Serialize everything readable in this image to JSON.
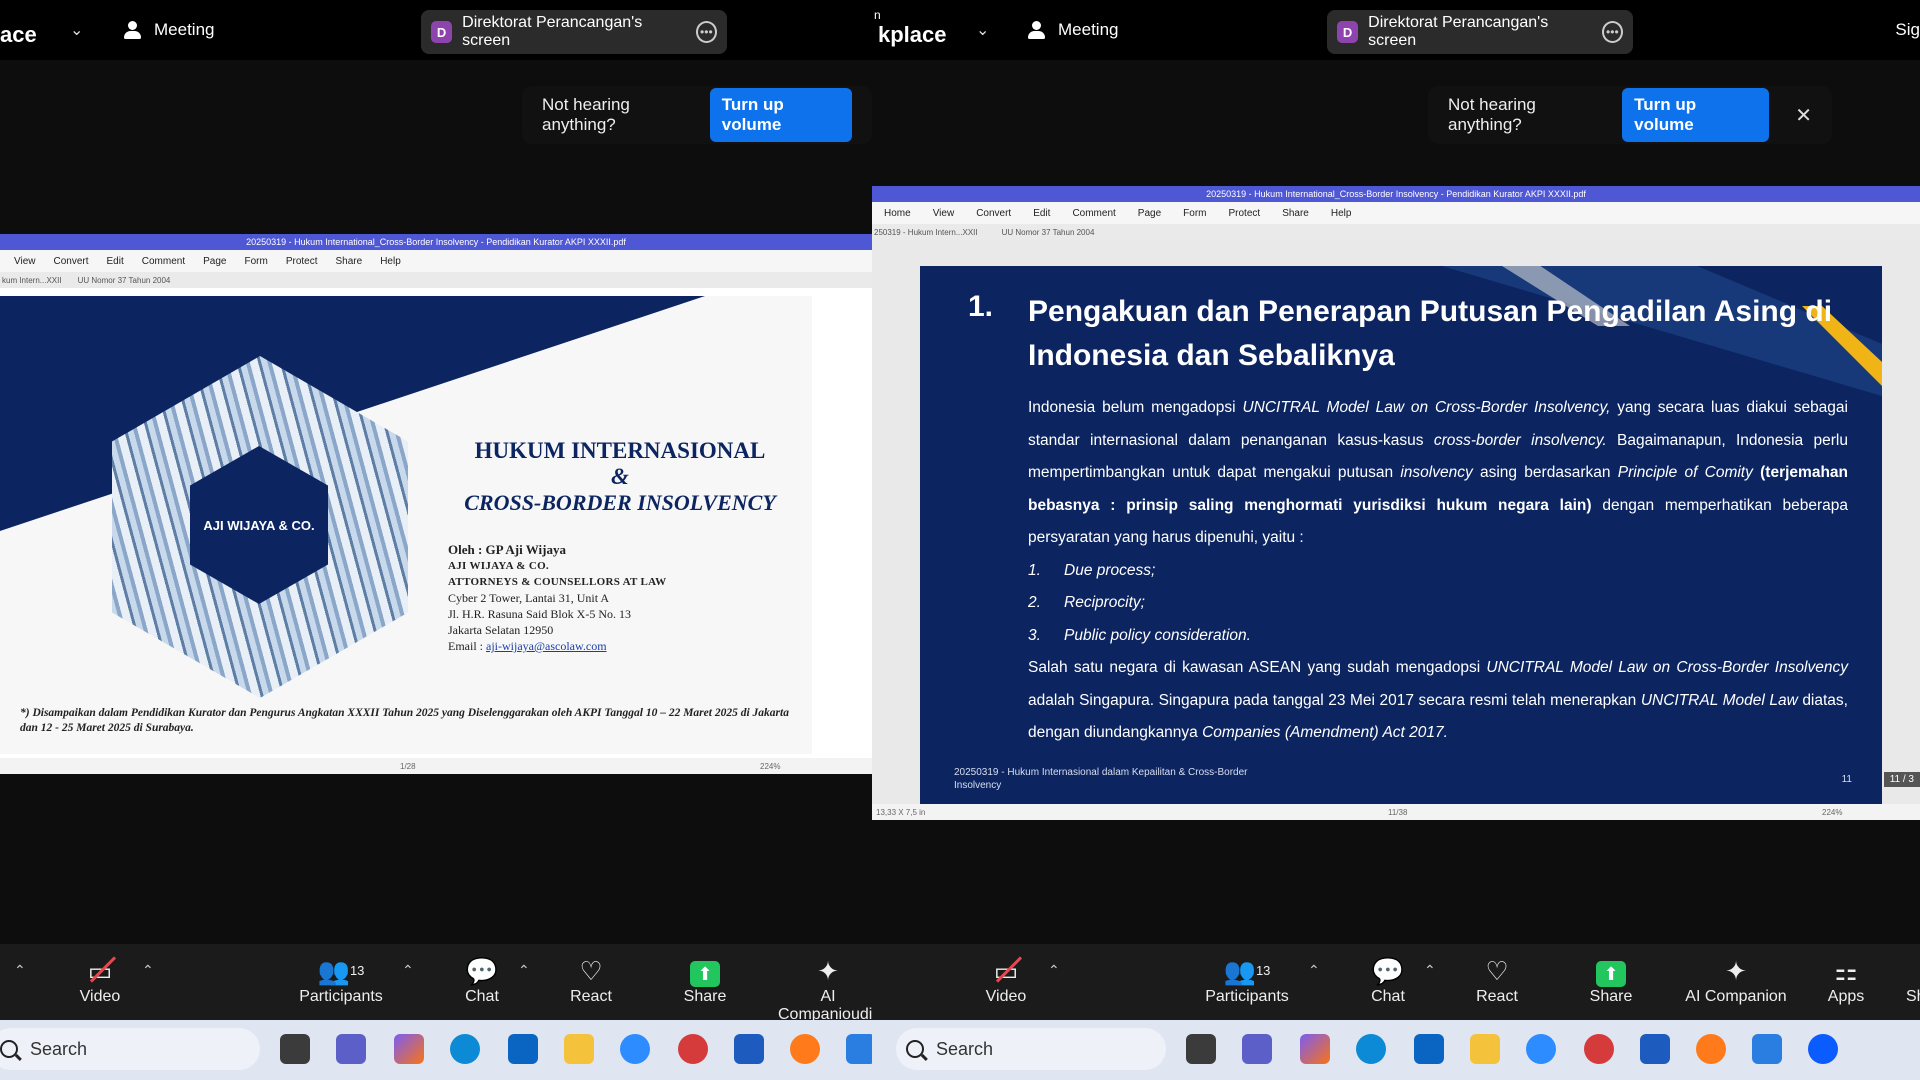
{
  "left": {
    "app_title": "ace",
    "meeting_label": "Meeting",
    "screen_share_label": "Direktorat Perancangan's screen",
    "screen_share_initial": "D",
    "notice_text": "Not hearing anything?",
    "notice_button": "Turn up volume",
    "pdf": {
      "title": "20250319 - Hukum International_Cross-Border Insolvency - Pendidikan Kurator AKPI XXXII.pdf",
      "menu": [
        "View",
        "Convert",
        "Edit",
        "Comment",
        "Page",
        "Form",
        "Protect",
        "Share",
        "Help"
      ],
      "tabs": [
        "kum Intern...XXII",
        "UU Nomor 37 Tahun 2004"
      ],
      "page_indicator": "1/28",
      "zoom": "224%"
    },
    "slide": {
      "logo_text": "AJI WIJAYA & CO.",
      "title_line1": "HUKUM INTERNASIONAL",
      "title_line2": "&",
      "title_line3": "CROSS-BORDER INSOLVENCY",
      "oleh": "Oleh : GP Aji Wijaya",
      "firm": "AJI WIJAYA & CO.",
      "firm_sub": "ATTORNEYS & COUNSELLORS AT LAW",
      "addr1": "Cyber 2 Tower, Lantai 31, Unit A",
      "addr2": "Jl. H.R. Rasuna Said Blok X-5 No. 13",
      "addr3": "Jakarta Selatan 12950",
      "email_label": "Email : ",
      "email": "aji-wijaya@ascolaw.com",
      "footnote": "*) Disampaikan dalam Pendidikan Kurator dan Pengurus Angkatan XXXII Tahun 2025 yang Diselenggarakan oleh AKPI Tanggal 10 – 22 Maret 2025 di Jakarta dan 12 - 25 Maret 2025 di Surabaya."
    },
    "toolbar": {
      "video": "Video",
      "participants": "Participants",
      "participants_count": "13",
      "chat": "Chat",
      "react": "React",
      "share": "Share",
      "ai": "AI Companio",
      "audio": "udio"
    },
    "search": "Search"
  },
  "right": {
    "app_top": "n",
    "app_title": "kplace",
    "meeting_label": "Meeting",
    "screen_share_label": "Direktorat Perancangan's screen",
    "screen_share_initial": "D",
    "sig": "Sig",
    "notice_text": "Not hearing anything?",
    "notice_button": "Turn up volume",
    "notice_close": "✕",
    "pdf": {
      "title": "20250319 - Hukum International_Cross-Border Insolvency - Pendidikan Kurator AKPI XXXII.pdf",
      "menu": [
        "Home",
        "View",
        "Convert",
        "Edit",
        "Comment",
        "Page",
        "Form",
        "Protect",
        "Share",
        "Help"
      ],
      "tabs": [
        "250319 - Hukum Intern...XXII",
        "UU Nomor 37 Tahun 2004"
      ],
      "size": "13,33 X 7,5 in",
      "page_indicator": "11/38",
      "zoom": "224%",
      "page_badge": "11 / 3"
    },
    "slide": {
      "num": "1.",
      "title": "Pengakuan dan Penerapan Putusan Pengadilan Asing di Indonesia dan Sebaliknya",
      "p1_a": "Indonesia belum mengadopsi ",
      "p1_b": "UNCITRAL Model Law on Cross-Border Insolvency,",
      "p1_c": " yang secara luas diakui sebagai standar internasional dalam penanganan kasus-kasus ",
      "p1_d": "cross-border insolvency.",
      "p1_e": " Bagaimanapun, Indonesia perlu mempertimbangkan untuk dapat mengakui putusan ",
      "p1_f": "insolvency",
      "p1_g": " asing berdasarkan ",
      "p1_h": "Principle of Comity",
      "p1_i": " (terjemahan bebasnya : prinsip saling menghormati yurisdiksi hukum negara lain)",
      "p1_j": " dengan memperhatikan beberapa persyaratan yang harus dipenuhi, yaitu :",
      "list": [
        {
          "n": "1.",
          "t": "Due process;"
        },
        {
          "n": "2.",
          "t": "Reciprocity;"
        },
        {
          "n": "3.",
          "t": "Public policy consideration."
        }
      ],
      "p2_a": "Salah satu negara di kawasan ASEAN yang sudah mengadopsi ",
      "p2_b": "UNCITRAL Model Law on Cross-Border Insolvency",
      "p2_c": " adalah Singapura. Singapura pada tanggal 23 Mei 2017 secara resmi telah menerapkan ",
      "p2_d": "UNCITRAL Model Law",
      "p2_e": " diatas, dengan diundangkannya ",
      "p2_f": "Companies (Amendment) Act 2017.",
      "footer": "20250319 - Hukum Internasional dalam Kepailitan & Cross-Border Insolvency",
      "page": "11"
    },
    "toolbar": {
      "video": "Video",
      "participants": "Participants",
      "participants_count": "13",
      "chat": "Chat",
      "react": "React",
      "share": "Share",
      "ai": "AI Companion",
      "apps": "Apps",
      "sh": "Sh"
    },
    "search": "Search"
  },
  "colors": {
    "slide_navy": "#0c2560",
    "zoom_blue": "#0e72ed",
    "share_green": "#22c55e",
    "badge_purple": "#8e44ad",
    "pdf_title_blue": "#4e57d4"
  }
}
